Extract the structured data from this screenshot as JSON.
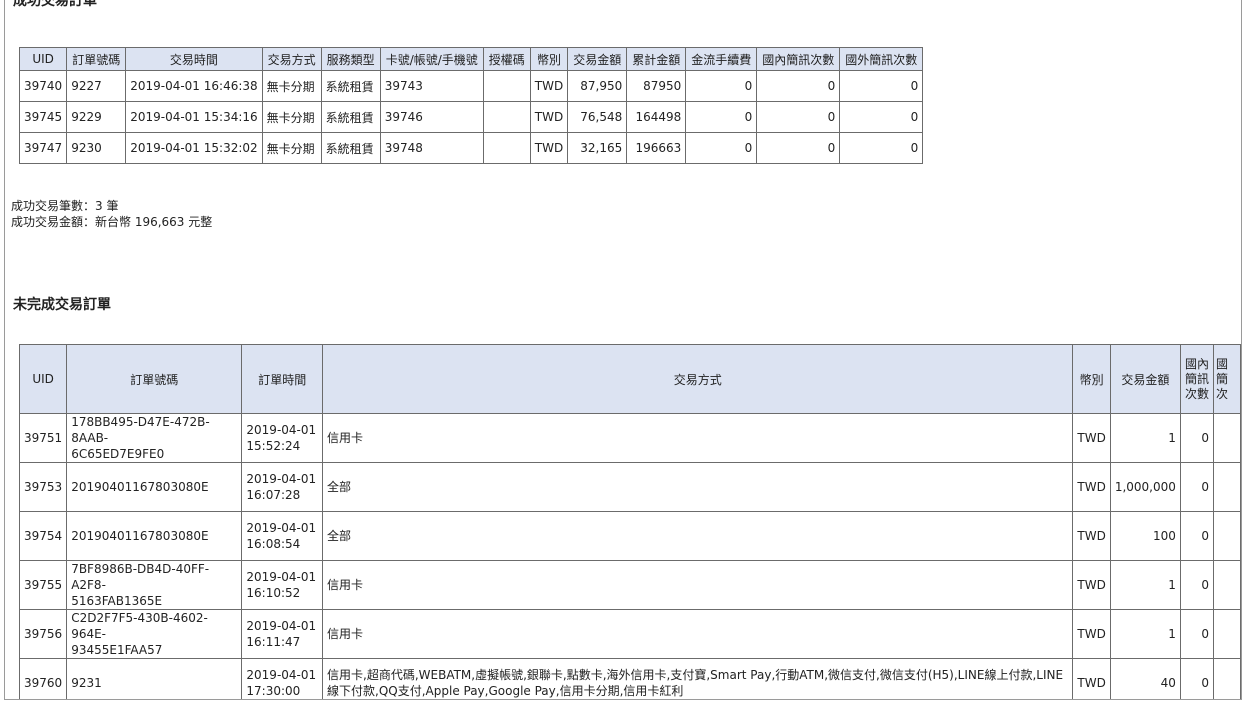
{
  "completed_section": {
    "title": "成功交易訂單",
    "headers": [
      "UID",
      "訂單號碼",
      "交易時間",
      "交易方式",
      "服務類型",
      "卡號/帳號/手機號",
      "授權碼",
      "幣別",
      "交易金額",
      "累計金額",
      "金流手續費",
      "國內簡訊次數",
      "國外簡訊次數"
    ],
    "rows": [
      {
        "uid": "39740",
        "order": "9227",
        "time": "2019-04-01 16:46:38",
        "method": "無卡分期",
        "service": "系統租賃",
        "card": "39743",
        "auth": "",
        "currency": "TWD",
        "amount": "87,950",
        "cumulative": "87950",
        "fee": "0",
        "sms_domestic": "0",
        "sms_foreign": "0"
      },
      {
        "uid": "39745",
        "order": "9229",
        "time": "2019-04-01 15:34:16",
        "method": "無卡分期",
        "service": "系統租賃",
        "card": "39746",
        "auth": "",
        "currency": "TWD",
        "amount": "76,548",
        "cumulative": "164498",
        "fee": "0",
        "sms_domestic": "0",
        "sms_foreign": "0"
      },
      {
        "uid": "39747",
        "order": "9230",
        "time": "2019-04-01 15:32:02",
        "method": "無卡分期",
        "service": "系統租賃",
        "card": "39748",
        "auth": "",
        "currency": "TWD",
        "amount": "32,165",
        "cumulative": "196663",
        "fee": "0",
        "sms_domestic": "0",
        "sms_foreign": "0"
      }
    ],
    "summary_count": "成功交易筆數：3 筆",
    "summary_amount": "成功交易金額：新台幣 196,663 元整"
  },
  "incomplete_section": {
    "title": "未完成交易訂單",
    "headers": {
      "uid": "UID",
      "order": "訂單號碼",
      "time": "訂單時間",
      "method": "交易方式",
      "currency": "幣別",
      "amount": "交易金額",
      "sms_domestic_l1": "國內",
      "sms_domestic_l2": "簡訊",
      "sms_domestic_l3": "次數",
      "sms_foreign_l1": "國",
      "sms_foreign_l2": "簡",
      "sms_foreign_l3": "次"
    },
    "rows": [
      {
        "uid": "39751",
        "order_l1": "178BB495-D47E-472B-8AAB-",
        "order_l2": "6C65ED7E9FE0",
        "date": "2019-04-01",
        "time": "15:52:24",
        "method": "信用卡",
        "method_l2": "",
        "currency": "TWD",
        "amount": "1",
        "sms": "0"
      },
      {
        "uid": "39753",
        "order_l1": "20190401167803080E",
        "order_l2": "",
        "date": "2019-04-01",
        "time": "16:07:28",
        "method": "全部",
        "method_l2": "",
        "currency": "TWD",
        "amount": "1,000,000",
        "sms": "0"
      },
      {
        "uid": "39754",
        "order_l1": "20190401167803080E",
        "order_l2": "",
        "date": "2019-04-01",
        "time": "16:08:54",
        "method": "全部",
        "method_l2": "",
        "currency": "TWD",
        "amount": "100",
        "sms": "0"
      },
      {
        "uid": "39755",
        "order_l1": "7BF8986B-DB4D-40FF-A2F8-",
        "order_l2": "5163FAB1365E",
        "date": "2019-04-01",
        "time": "16:10:52",
        "method": "信用卡",
        "method_l2": "",
        "currency": "TWD",
        "amount": "1",
        "sms": "0"
      },
      {
        "uid": "39756",
        "order_l1": "C2D2F7F5-430B-4602-964E-",
        "order_l2": "93455E1FAA57",
        "date": "2019-04-01",
        "time": "16:11:47",
        "method": "信用卡",
        "method_l2": "",
        "currency": "TWD",
        "amount": "1",
        "sms": "0"
      },
      {
        "uid": "39760",
        "order_l1": "9231",
        "order_l2": "",
        "date": "2019-04-01",
        "time": "17:30:00",
        "method": "信用卡,超商代碼,WEBATM,虛擬帳號,銀聯卡,點數卡,海外信用卡,支付寶,Smart Pay,行動ATM,微信支付,微信支付(H5),LINE線上付款,LINE",
        "method_l2": "線下付款,QQ支付,Apple Pay,Google Pay,信用卡分期,信用卡紅利",
        "currency": "TWD",
        "amount": "40",
        "sms": "0"
      }
    ]
  }
}
